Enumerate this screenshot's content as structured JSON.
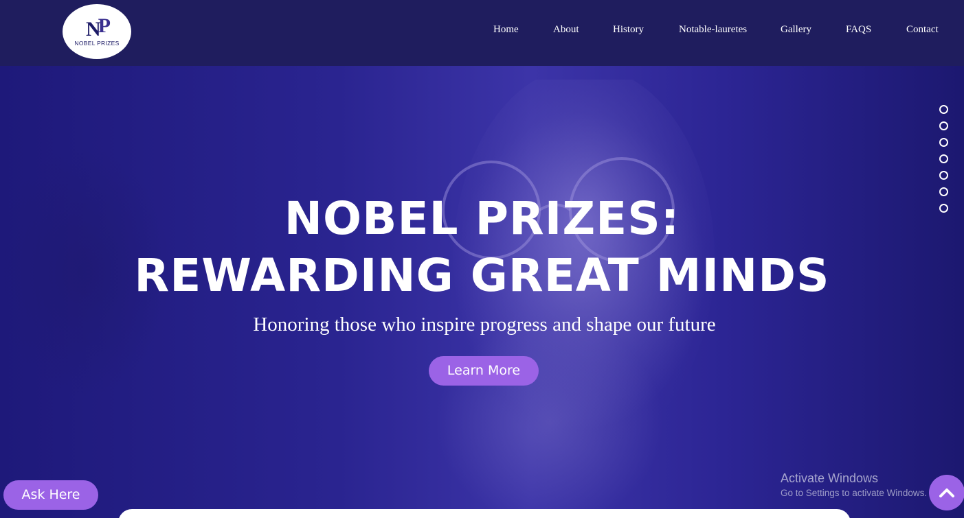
{
  "brand": {
    "logo_mark_n": "N",
    "logo_mark_p": "P",
    "logo_text": "NOBEL PRIZES"
  },
  "nav": {
    "items": [
      {
        "label": "Home"
      },
      {
        "label": "About"
      },
      {
        "label": "History"
      },
      {
        "label": "Notable-lauretes"
      },
      {
        "label": "Gallery"
      },
      {
        "label": "FAQS"
      },
      {
        "label": "Contact"
      }
    ]
  },
  "hero": {
    "title_line1": "NOBEL PRIZES:",
    "title_line2": "REWARDING GREAT MINDS",
    "subtitle": "Honoring those who inspire progress and shape our future",
    "cta_label": "Learn More",
    "slide_count": 7
  },
  "ask_button": {
    "label": "Ask Here"
  },
  "scroll_top_button": {
    "icon": "chevron-up-icon"
  },
  "watermark": {
    "title": "Activate Windows",
    "subtitle": "Go to Settings to activate Windows."
  },
  "colors": {
    "navbar": "#1f1d5e",
    "hero_tint": "#2a2490",
    "accent": "#9b63e6",
    "text": "#ffffff"
  }
}
